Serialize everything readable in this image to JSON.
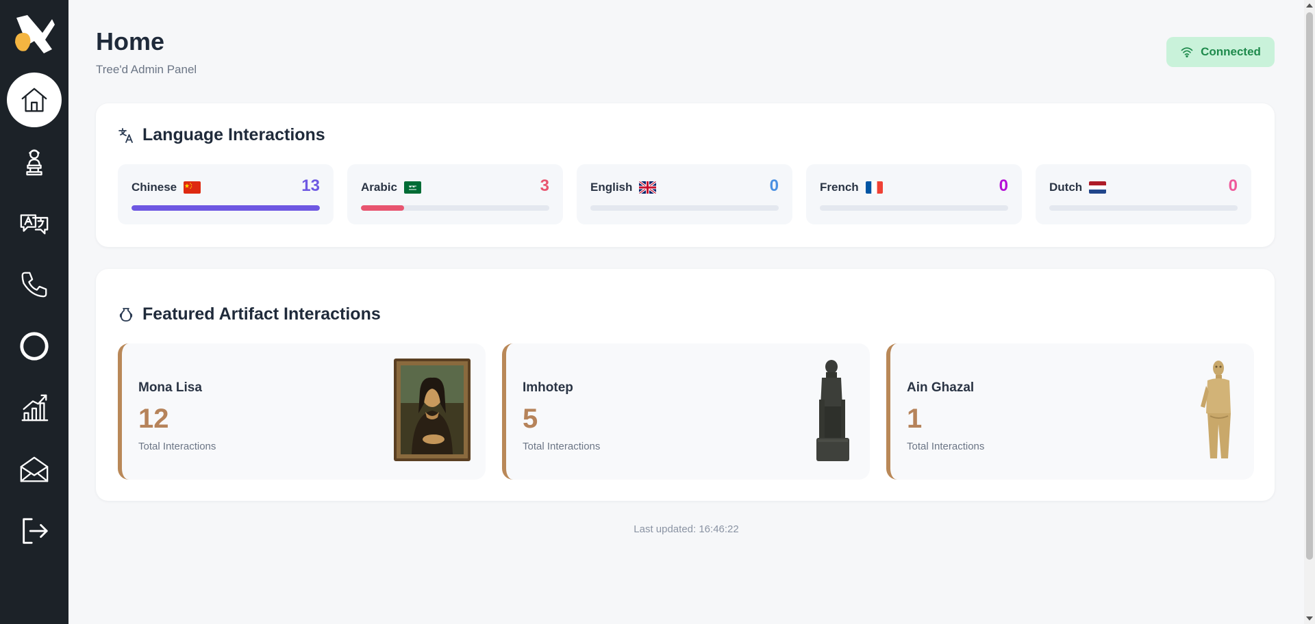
{
  "header": {
    "title": "Home",
    "subtitle": "Tree'd Admin Panel",
    "status": "Connected"
  },
  "sidebar": {
    "items": [
      {
        "icon": "home-icon",
        "active": true
      },
      {
        "icon": "statue-bust-icon"
      },
      {
        "icon": "translate-chat-icon"
      },
      {
        "icon": "phone-icon"
      },
      {
        "icon": "circle-icon"
      },
      {
        "icon": "chart-growth-icon"
      },
      {
        "icon": "mail-open-icon"
      },
      {
        "icon": "logout-icon"
      }
    ]
  },
  "languages": {
    "title": "Language Interactions",
    "items": [
      {
        "name": "Chinese",
        "count": "13",
        "color": "#6e58e2",
        "fraction": 1.0,
        "flag": "china-flag-icon"
      },
      {
        "name": "Arabic",
        "count": "3",
        "color": "#e85570",
        "fraction": 0.23,
        "flag": "saudi-flag-icon"
      },
      {
        "name": "English",
        "count": "0",
        "color": "#4a90e2",
        "fraction": 0,
        "flag": "uk-flag-icon"
      },
      {
        "name": "French",
        "count": "0",
        "color": "#b50fd6",
        "fraction": 0,
        "flag": "france-flag-icon"
      },
      {
        "name": "Dutch",
        "count": "0",
        "color": "#ef5a9b",
        "fraction": 0,
        "flag": "netherlands-flag-icon"
      }
    ]
  },
  "artifacts": {
    "title": "Featured Artifact Interactions",
    "items": [
      {
        "name": "Mona Lisa",
        "count": "12",
        "label": "Total Interactions"
      },
      {
        "name": "Imhotep",
        "count": "5",
        "label": "Total Interactions"
      },
      {
        "name": "Ain Ghazal",
        "count": "1",
        "label": "Total Interactions"
      }
    ]
  },
  "footer": {
    "last_updated": "Last updated: 16:46:22"
  },
  "colors": {
    "sidebar": "#1c2228",
    "accent_artifact": "#b6835a",
    "status_bg": "#c9f2da",
    "status_text": "#1e8a4c"
  }
}
